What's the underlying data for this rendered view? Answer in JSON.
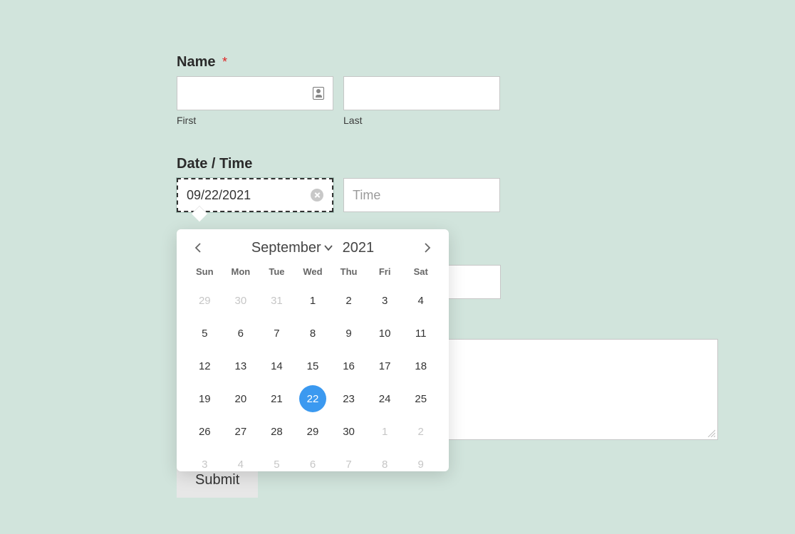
{
  "name_section": {
    "label": "Name",
    "required_marker": "*",
    "first_value": "",
    "first_caption": "First",
    "last_value": "",
    "last_caption": "Last"
  },
  "datetime_section": {
    "label": "Date / Time",
    "date_value": "09/22/2021",
    "time_placeholder": "Time"
  },
  "calendar": {
    "month_label": "September",
    "year_label": "2021",
    "days_of_week": {
      "sun": "Sun",
      "mon": "Mon",
      "tue": "Tue",
      "wed": "Wed",
      "thu": "Thu",
      "fri": "Fri",
      "sat": "Sat"
    },
    "selected_day": 22,
    "grid": {
      "r0": {
        "c0": {
          "n": "29",
          "out": true
        },
        "c1": {
          "n": "30",
          "out": true
        },
        "c2": {
          "n": "31",
          "out": true
        },
        "c3": {
          "n": "1"
        },
        "c4": {
          "n": "2"
        },
        "c5": {
          "n": "3"
        },
        "c6": {
          "n": "4"
        }
      },
      "r1": {
        "c0": {
          "n": "5"
        },
        "c1": {
          "n": "6"
        },
        "c2": {
          "n": "7"
        },
        "c3": {
          "n": "8"
        },
        "c4": {
          "n": "9"
        },
        "c5": {
          "n": "10"
        },
        "c6": {
          "n": "11"
        }
      },
      "r2": {
        "c0": {
          "n": "12"
        },
        "c1": {
          "n": "13"
        },
        "c2": {
          "n": "14"
        },
        "c3": {
          "n": "15"
        },
        "c4": {
          "n": "16"
        },
        "c5": {
          "n": "17"
        },
        "c6": {
          "n": "18"
        }
      },
      "r3": {
        "c0": {
          "n": "19"
        },
        "c1": {
          "n": "20"
        },
        "c2": {
          "n": "21"
        },
        "c3": {
          "n": "22",
          "sel": true
        },
        "c4": {
          "n": "23"
        },
        "c5": {
          "n": "24"
        },
        "c6": {
          "n": "25"
        }
      },
      "r4": {
        "c0": {
          "n": "26"
        },
        "c1": {
          "n": "27"
        },
        "c2": {
          "n": "28"
        },
        "c3": {
          "n": "29"
        },
        "c4": {
          "n": "30"
        },
        "c5": {
          "n": "1",
          "out": true
        },
        "c6": {
          "n": "2",
          "out": true
        }
      },
      "r5": {
        "c0": {
          "n": "3",
          "out": true
        },
        "c1": {
          "n": "4",
          "out": true
        },
        "c2": {
          "n": "5",
          "out": true
        },
        "c3": {
          "n": "6",
          "out": true
        },
        "c4": {
          "n": "7",
          "out": true
        },
        "c5": {
          "n": "8",
          "out": true
        },
        "c6": {
          "n": "9",
          "out": true
        }
      }
    }
  },
  "submit_label": "Submit"
}
